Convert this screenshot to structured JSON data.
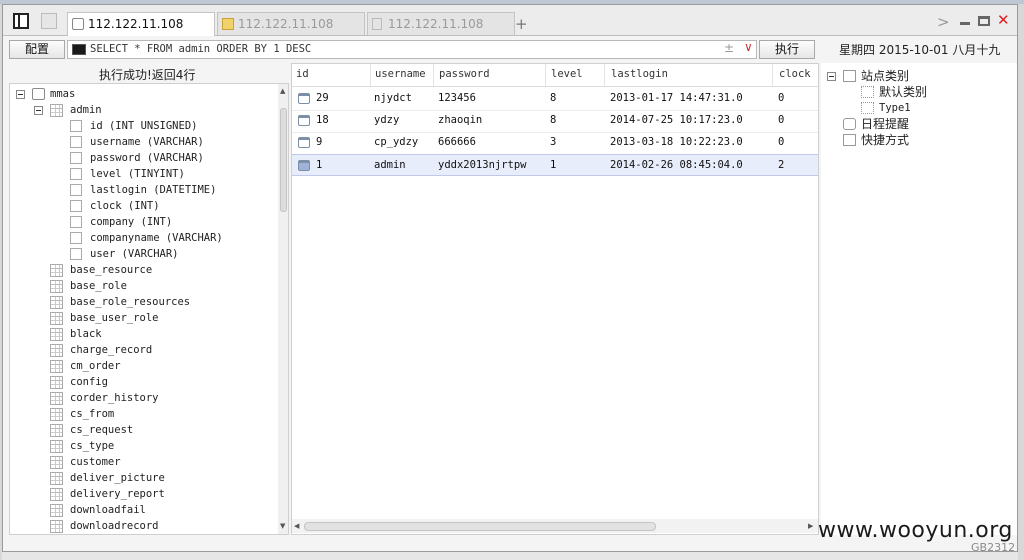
{
  "tabs": [
    {
      "label": "112.122.11.108",
      "icon": "database-icon",
      "active": true
    },
    {
      "label": "112.122.11.108",
      "icon": "folder-icon",
      "active": false
    },
    {
      "label": "112.122.11.108",
      "icon": "document-icon",
      "active": false
    }
  ],
  "toolbar": {
    "config_label": "配置",
    "query": "SELECT * FROM admin ORDER BY 1 DESC",
    "plus_minus": "±",
    "dropdown": "∨",
    "execute_label": "执行",
    "date_text": "星期四 2015-10-01 八月十九"
  },
  "status": "执行成功!返回4行",
  "tree": {
    "db": "mmas",
    "table": "admin",
    "columns": [
      "id (INT UNSIGNED)",
      "username (VARCHAR)",
      "password (VARCHAR)",
      "level (TINYINT)",
      "lastlogin (DATETIME)",
      "clock (INT)",
      "company (INT)",
      "companyname (VARCHAR)",
      "user (VARCHAR)"
    ],
    "tables": [
      "base_resource",
      "base_role",
      "base_role_resources",
      "base_user_role",
      "black",
      "charge_record",
      "cm_order",
      "config",
      "corder_history",
      "cs_from",
      "cs_request",
      "cs_type",
      "customer",
      "deliver_picture",
      "delivery_report",
      "downloadfail",
      "downloadrecord"
    ]
  },
  "grid": {
    "headers": [
      "id",
      "username",
      "password",
      "level",
      "lastlogin",
      "clock"
    ],
    "rows": [
      [
        "29",
        "njydct",
        "123456",
        "8",
        "2013-01-17 14:47:31.0",
        "0"
      ],
      [
        "18",
        "ydzy",
        "zhaoqin",
        "8",
        "2014-07-25 10:17:23.0",
        "0"
      ],
      [
        "9",
        "cp_ydzy",
        "666666",
        "3",
        "2013-03-18 10:22:23.0",
        "0"
      ],
      [
        "1",
        "admin",
        "yddx2013njrtpw",
        "1",
        "2014-02-26 08:45:04.0",
        "2"
      ]
    ],
    "selected_row": 3
  },
  "right_tree": {
    "site_category": "站点类别",
    "default_category": "默认类别",
    "type1": "Type1",
    "schedule": "日程提醒",
    "shortcut": "快捷方式"
  },
  "watermark": "www.wooyun.org",
  "encoding": "GB2312"
}
